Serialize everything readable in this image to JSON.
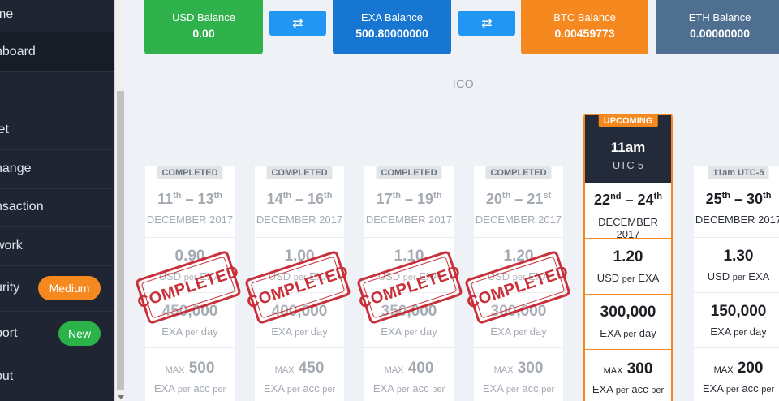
{
  "sidebar": {
    "items": [
      {
        "label": "me"
      },
      {
        "label": "hboard"
      },
      {
        "label": "let"
      },
      {
        "label": "hange"
      },
      {
        "label": "nsaction"
      },
      {
        "label": "work"
      },
      {
        "label": "urity"
      },
      {
        "label": "port"
      },
      {
        "label": "out"
      }
    ],
    "security_badge": "Medium",
    "support_badge": "New"
  },
  "balances": [
    {
      "title": "USD Balance",
      "value": "0.00",
      "color": "#2fb14b"
    },
    {
      "title": "EXA Balance",
      "value": "500.80000000",
      "color": "#1676d2"
    },
    {
      "title": "BTC Balance",
      "value": "0.00459773",
      "color": "#f5891f"
    },
    {
      "title": "ETH Balance",
      "value": "0.00000000",
      "color": "#4e6f8f"
    }
  ],
  "swap_icon": "swap-arrows-icon",
  "section_label": "ICO",
  "cards": [
    {
      "badge": "COMPLETED",
      "d1": "11",
      "s1": "th",
      "d2": "13",
      "s2": "th",
      "month": "DECEMBER 2017",
      "price": "0.90",
      "price_unit_a": "USD",
      "price_unit_b": "per",
      "price_unit_c": "EXA",
      "per_day": "450,000",
      "day_a": "EXA",
      "day_b": "per",
      "day_c": "day",
      "max_prefix": "MAX",
      "max": "500",
      "acc_a": "EXA",
      "acc_b": "per",
      "acc_c": "acc",
      "acc_d": "per",
      "stamp": "COMPLETED"
    },
    {
      "badge": "COMPLETED",
      "d1": "14",
      "s1": "th",
      "d2": "16",
      "s2": "th",
      "month": "DECEMBER 2017",
      "price": "1.00",
      "price_unit_a": "USD",
      "price_unit_b": "per",
      "price_unit_c": "EXA",
      "per_day": "400,000",
      "day_a": "EXA",
      "day_b": "per",
      "day_c": "day",
      "max_prefix": "MAX",
      "max": "450",
      "acc_a": "EXA",
      "acc_b": "per",
      "acc_c": "acc",
      "acc_d": "per",
      "stamp": "COMPLETED"
    },
    {
      "badge": "COMPLETED",
      "d1": "17",
      "s1": "th",
      "d2": "19",
      "s2": "th",
      "month": "DECEMBER 2017",
      "price": "1.10",
      "price_unit_a": "USD",
      "price_unit_b": "per",
      "price_unit_c": "EXA",
      "per_day": "350,000",
      "day_a": "EXA",
      "day_b": "per",
      "day_c": "day",
      "max_prefix": "MAX",
      "max": "400",
      "acc_a": "EXA",
      "acc_b": "per",
      "acc_c": "acc",
      "acc_d": "per",
      "stamp": "COMPLETED"
    },
    {
      "badge": "COMPLETED",
      "d1": "20",
      "s1": "th",
      "d2": "21",
      "s2": "st",
      "month": "DECEMBER 2017",
      "price": "1.20",
      "price_unit_a": "USD",
      "price_unit_b": "per",
      "price_unit_c": "EXA",
      "per_day": "300,000",
      "day_a": "EXA",
      "day_b": "per",
      "day_c": "day",
      "max_prefix": "MAX",
      "max": "300",
      "acc_a": "EXA",
      "acc_b": "per",
      "acc_c": "acc",
      "acc_d": "per",
      "stamp": "COMPLETED"
    },
    {
      "badge": "UPCOMING",
      "time": "11am",
      "tz": "UTC-5",
      "d1": "22",
      "s1": "nd",
      "d2": "24",
      "s2": "th",
      "month": "DECEMBER 2017",
      "price": "1.20",
      "price_unit_a": "USD",
      "price_unit_b": "per",
      "price_unit_c": "EXA",
      "per_day": "300,000",
      "day_a": "EXA",
      "day_b": "per",
      "day_c": "day",
      "max_prefix": "MAX",
      "max": "300",
      "acc_a": "EXA",
      "acc_b": "per",
      "acc_c": "acc",
      "acc_d": "per"
    },
    {
      "badge": "11am UTC-5",
      "d1": "25",
      "s1": "th",
      "d2": "30",
      "s2": "th",
      "month": "DECEMBER 2017",
      "price": "1.30",
      "price_unit_a": "USD",
      "price_unit_b": "per",
      "price_unit_c": "EXA",
      "per_day": "150,000",
      "day_a": "EXA",
      "day_b": "per",
      "day_c": "day",
      "max_prefix": "MAX",
      "max": "200",
      "acc_a": "EXA",
      "acc_b": "per",
      "acc_c": "acc",
      "acc_d": "per"
    }
  ]
}
